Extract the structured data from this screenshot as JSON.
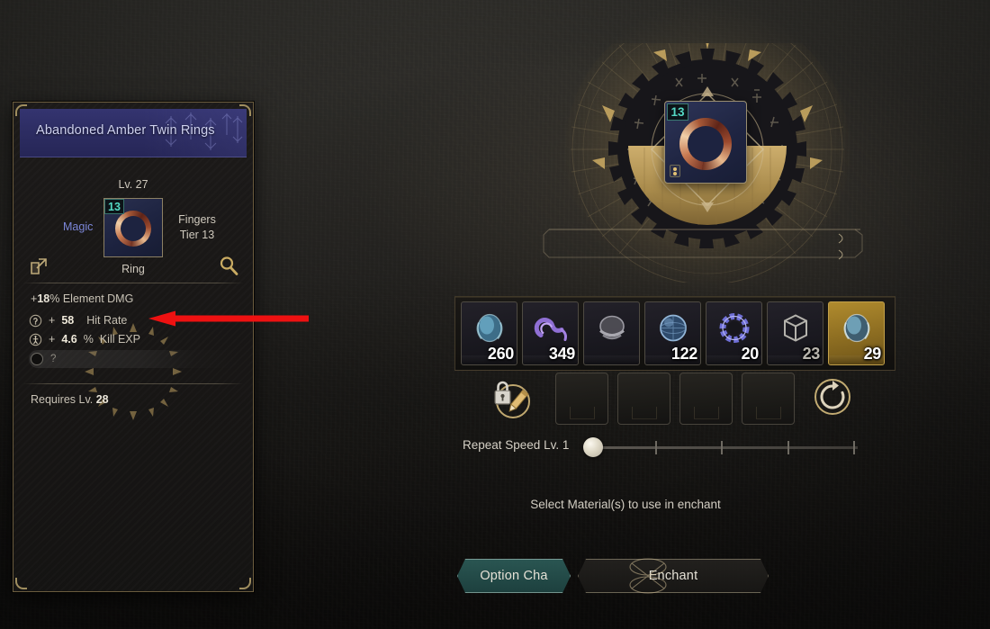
{
  "theme": {
    "accent_gold": "#b79a5e",
    "accent_teal": "#54d8c4",
    "magic_blue": "#7b86d8",
    "header_blue": "#2d2d63",
    "annotation_red": "#ee1111",
    "panel_bg": "#191716",
    "text_primary": "#d5d0c5",
    "legendary_gold": "#8f6f22"
  },
  "tooltip": {
    "title": "Abandoned Amber Twin Rings",
    "level_label": "Lv. 27",
    "rarity": "Magic",
    "slot": "Fingers",
    "tier": "Tier 13",
    "type": "Ring",
    "enhance_level": "13",
    "share_icon": "share-icon",
    "inspect_icon": "magnifier-icon",
    "main_stat": {
      "prefix": "+",
      "value": "18",
      "unit": "%",
      "label": "Element DMG"
    },
    "stats": [
      {
        "icon": "hit-rate-icon",
        "prefix": "+",
        "value": "58",
        "unit": "",
        "label": "Hit Rate"
      },
      {
        "icon": "kill-exp-icon",
        "prefix": "+",
        "value": "4.6",
        "unit": "%",
        "label": "Kill EXP"
      }
    ],
    "locked_slot": {
      "icon": "locked-option-icon",
      "text": "?"
    },
    "requirement": {
      "label": "Requires Lv.",
      "value": "28"
    }
  },
  "annotation": {
    "type": "arrow",
    "direction": "left",
    "points_at": "kill-exp-stat",
    "color": "#ee1111"
  },
  "enchant": {
    "wheel_item": {
      "enhance_level": "13",
      "icon": "ring-item-icon"
    },
    "materials": [
      {
        "icon": "blue-orb-icon",
        "count": "260",
        "rarity": "rare",
        "dim": false
      },
      {
        "icon": "purple-serpent-icon",
        "count": "349",
        "rarity": "epic",
        "dim": false
      },
      {
        "icon": "gray-coil-icon",
        "count": "",
        "rarity": "common",
        "dim": true
      },
      {
        "icon": "blue-sphere-icon",
        "count": "122",
        "rarity": "rare",
        "dim": false
      },
      {
        "icon": "rune-circle-icon",
        "count": "20",
        "rarity": "epic",
        "dim": false
      },
      {
        "icon": "wire-cube-icon",
        "count": "23",
        "rarity": "common",
        "dim": true
      },
      {
        "icon": "gold-orb-icon",
        "count": "29",
        "rarity": "legendary",
        "dim": false
      },
      {
        "icon": "partial-icon",
        "count": "",
        "rarity": "common",
        "dim": true
      }
    ],
    "lock_edit_icon": "lock-pencil-icon",
    "reset_icon": "reset-icon",
    "material_slots": [
      {
        "label": "",
        "filled": false
      },
      {
        "label": "",
        "filled": false
      },
      {
        "label": "",
        "filled": false
      },
      {
        "label": "",
        "filled": false
      }
    ],
    "repeat_speed": {
      "label": "Repeat Speed Lv. 1",
      "value": 1,
      "min": 1,
      "max": 5,
      "ticks": 4
    },
    "hint": "Select Material(s) to use in enchant",
    "buttons": {
      "option_change": "Option Cha",
      "enchant": "Enchant"
    }
  }
}
